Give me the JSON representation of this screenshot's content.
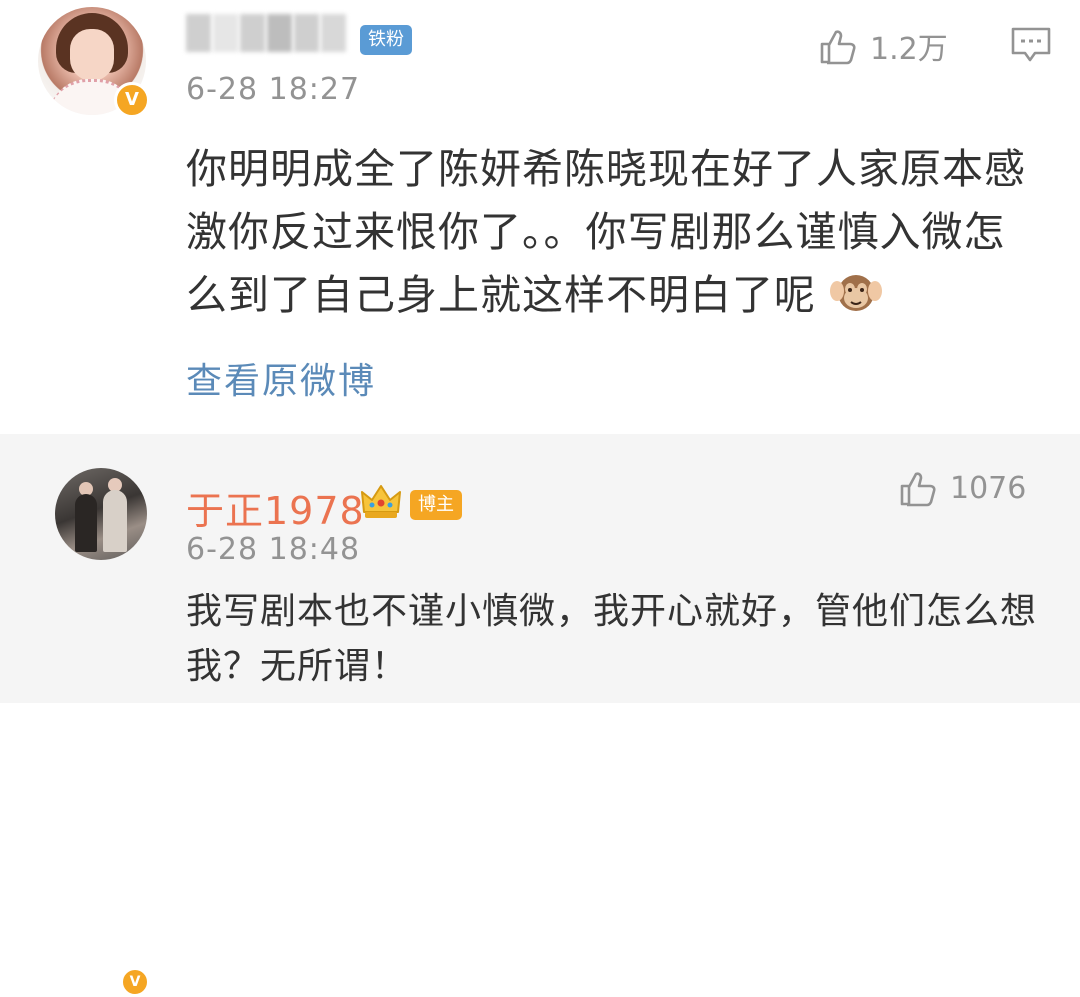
{
  "comment": {
    "badge": "铁粉",
    "like_count": "1.2万",
    "time": "6-28 18:27",
    "text": "你明明成全了陈妍希陈晓现在好了人家原本感激你反过来恨你了。。你写剧那么谨慎入微怎么到了自己身上就这样不明白了呢",
    "emoji": "hear-no-evil-monkey",
    "view_original": "查看原微博",
    "verified_mark": "V"
  },
  "reply": {
    "username": "于正1978",
    "badge": "博主",
    "like_count": "1076",
    "time": "6-28 18:48",
    "text": "我写剧本也不谨小慎微，我开心就好，管他们怎么想我？无所谓！",
    "verified_mark": "V"
  },
  "colors": {
    "username_orange": "#eb7350",
    "link_blue": "#5b8ab8",
    "fan_badge_blue": "#5a9bd5",
    "blogger_badge_orange": "#f5a623",
    "meta_gray": "#939393",
    "reply_bg": "#f5f5f5"
  }
}
